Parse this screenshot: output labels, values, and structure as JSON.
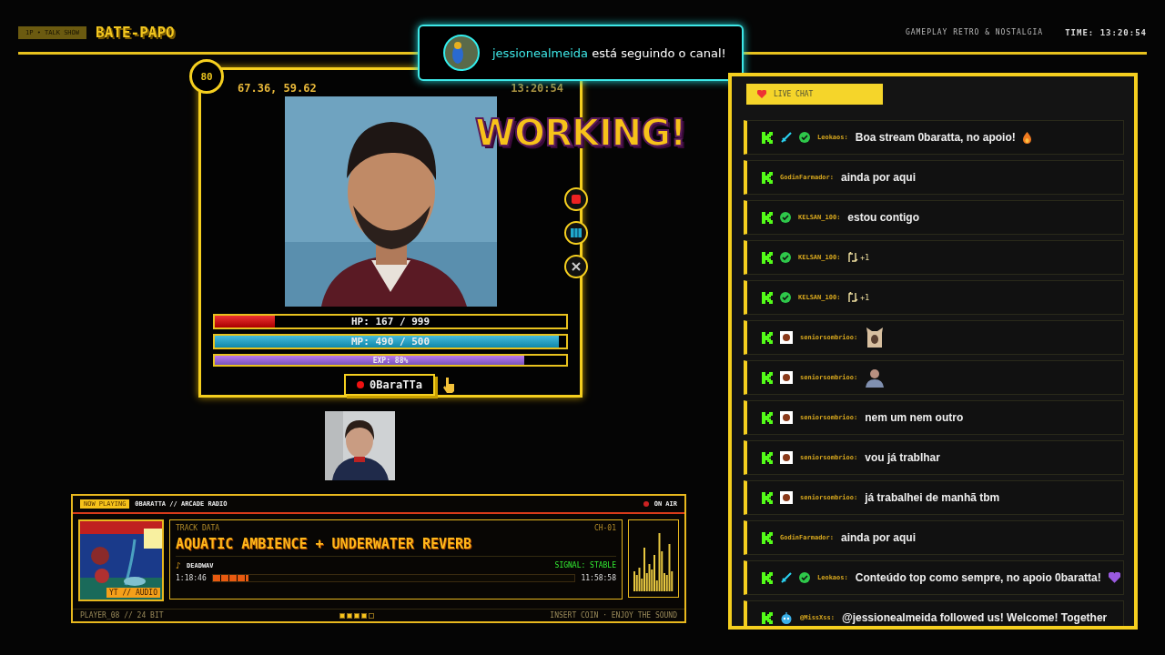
{
  "header": {
    "badge": "1P • TALK SHOW",
    "title": "BATE-PAPO",
    "tagline": "GAMEPLAY RETRO & NOSTALGIA",
    "time": "TIME: 13:20:54"
  },
  "notification": {
    "user": "jessionealmeida",
    "message": "está seguindo o canal!"
  },
  "player_card": {
    "level_badge": "80",
    "coords": "67.36, 59.62",
    "clock": "13:20:54",
    "overlay_text": "WORKING!",
    "name": "0BaraTTa",
    "bars": [
      {
        "kind": "hp",
        "label": "HP: 167 / 999",
        "level": 0.17
      },
      {
        "kind": "mp",
        "label": "MP: 490 / 500",
        "level": 0.98
      },
      {
        "kind": "exp",
        "label": "EXP: 88%",
        "level": 0.88
      }
    ]
  },
  "chat": {
    "title": "LIVE CHAT",
    "messages": [
      {
        "user": "Leokaos:",
        "badges": [
          {
            "kind": "kick"
          },
          {
            "kind": "sword"
          },
          {
            "kind": "verified"
          }
        ],
        "kind": "text",
        "text": "Boa stream 0baratta, no apoio!",
        "end_emoji": {
          "kind": "fire"
        }
      },
      {
        "user": "GodinFarmador:",
        "badges": [
          {
            "kind": "kick"
          }
        ],
        "kind": "text",
        "text": "ainda por aqui"
      },
      {
        "user": "KELSAN_100:",
        "badges": [
          {
            "kind": "kick"
          },
          {
            "kind": "verified"
          }
        ],
        "kind": "text",
        "text": "estou contigo"
      },
      {
        "user": "KELSAN_100:",
        "badges": [
          {
            "kind": "kick"
          },
          {
            "kind": "verified"
          }
        ],
        "kind": "repost",
        "text": "+1"
      },
      {
        "user": "KELSAN_100:",
        "badges": [
          {
            "kind": "kick"
          },
          {
            "kind": "verified"
          }
        ],
        "kind": "repost",
        "text": "+1"
      },
      {
        "user": "seniorsombrioo:",
        "badges": [
          {
            "kind": "kick"
          },
          {
            "kind": "avatar"
          }
        ],
        "kind": "emote",
        "emote": {
          "kind": "cat"
        }
      },
      {
        "user": "seniorsombrioo:",
        "badges": [
          {
            "kind": "kick"
          },
          {
            "kind": "avatar"
          }
        ],
        "kind": "emote",
        "emote": {
          "kind": "man"
        }
      },
      {
        "user": "seniorsombrioo:",
        "badges": [
          {
            "kind": "kick"
          },
          {
            "kind": "avatar"
          }
        ],
        "kind": "text",
        "text": "nem um nem outro"
      },
      {
        "user": "seniorsombrioo:",
        "badges": [
          {
            "kind": "kick"
          },
          {
            "kind": "avatar"
          }
        ],
        "kind": "text",
        "text": "vou já trablhar"
      },
      {
        "user": "seniorsombrioo:",
        "badges": [
          {
            "kind": "kick"
          },
          {
            "kind": "avatar"
          }
        ],
        "kind": "text",
        "text": "já trabalhei de manhã tbm"
      },
      {
        "user": "GodinFarmador:",
        "badges": [
          {
            "kind": "kick"
          }
        ],
        "kind": "text",
        "text": "ainda por aqui"
      },
      {
        "user": "Leokaos:",
        "badges": [
          {
            "kind": "kick"
          },
          {
            "kind": "sword"
          },
          {
            "kind": "verified"
          }
        ],
        "kind": "text",
        "text": "Conteúdo top como sempre, no apoio 0baratta!",
        "end_emoji": {
          "kind": "heart"
        }
      },
      {
        "user": "@MissXss:",
        "badges": [
          {
            "kind": "kick"
          },
          {
            "kind": "bot"
          }
        ],
        "kind": "text",
        "text": "@jessionealmeida followed us! Welcome! Together"
      }
    ]
  },
  "now_playing": {
    "badge": "NOW PLAYING",
    "station": "0BARATTA // ARCADE RADIO",
    "status": "ON AIR",
    "art_tag": "YT // AUDIO",
    "section": "TRACK DATA",
    "channel": "CH-01",
    "title": "AQUATIC AMBIENCE + UNDERWATER REVERB",
    "note": "♪",
    "artist": "DEADWAV",
    "signal": "SIGNAL: STABLE",
    "elapsed": "1:18:46",
    "duration": "11:58:58",
    "level": 0.1,
    "footer_left": "PLAYER_08 // 24 BIT",
    "footer_right": "INSERT COIN · ENJOY THE SOUND",
    "lights": [
      {
        "on": true
      },
      {
        "on": true
      },
      {
        "on": true
      },
      {
        "on": true
      },
      {
        "on": false
      }
    ]
  }
}
